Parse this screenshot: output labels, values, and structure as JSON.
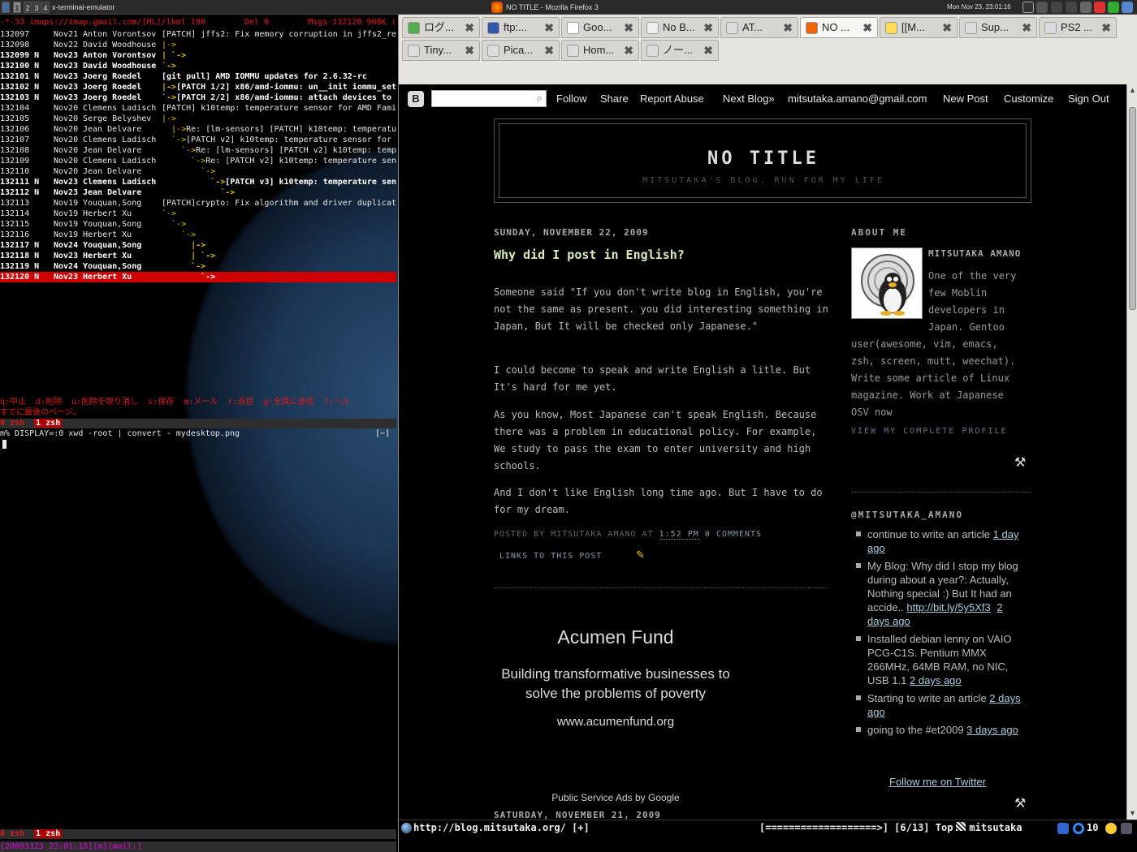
{
  "panel": {
    "workspaces": [
      "1",
      "2",
      "3",
      "4"
    ],
    "terminal_title": "x-terminal-emulator",
    "firefox_title": "NO TITLE - Mozilla Firefox 3",
    "clock": "Mon Nov 23, 23:01:16"
  },
  "mutt": {
    "header": "-*-33 imaps://imap.gmail.com/[ML]/lkml 198        Del 0        Msgs 132120 908K (end)",
    "messages": [
      {
        "num": "132097",
        "flag": "",
        "date": "Nov21",
        "from": "Anton Vorontsov",
        "subject": "[PATCH] jffs2: Fix memory corruption in jffs2_re",
        "bold": false,
        "tree": ""
      },
      {
        "num": "132098",
        "flag": "",
        "date": "Nov22",
        "from": "David Woodhouse",
        "subject": "",
        "bold": false,
        "tree": "|->"
      },
      {
        "num": "132099",
        "flag": "N",
        "date": "Nov23",
        "from": "Anton Vorontsov",
        "subject": "",
        "bold": true,
        "tree": "| `->"
      },
      {
        "num": "132100",
        "flag": "N",
        "date": "Nov23",
        "from": "David Woodhouse",
        "subject": "",
        "bold": true,
        "tree": "`->"
      },
      {
        "num": "132101",
        "flag": "N",
        "date": "Nov23",
        "from": "Joerg Roedel",
        "subject": "[git pull] AMD IOMMU updates for 2.6.32-rc",
        "bold": true,
        "tree": ""
      },
      {
        "num": "132102",
        "flag": "N",
        "date": "Nov23",
        "from": "Joerg Roedel",
        "subject": "[PATCH 1/2] x86/amd-iommu: un__init iommu_set",
        "bold": true,
        "tree": "|->"
      },
      {
        "num": "132103",
        "flag": "N",
        "date": "Nov23",
        "from": "Joerg Roedel",
        "subject": "[PATCH 2/2] x86/amd-iommu: attach devices to",
        "bold": true,
        "tree": "`->"
      },
      {
        "num": "132104",
        "flag": "",
        "date": "Nov20",
        "from": "Clemens Ladisch",
        "subject": "[PATCH] k10temp: temperature sensor for AMD Fami",
        "bold": false,
        "tree": ""
      },
      {
        "num": "132105",
        "flag": "",
        "date": "Nov20",
        "from": "Serge Belyshev",
        "subject": "",
        "bold": false,
        "tree": "|->"
      },
      {
        "num": "132106",
        "flag": "",
        "date": "Nov20",
        "from": "Jean Delvare",
        "subject": "Re: [lm-sensors] [PATCH] k10temp: temperatu",
        "bold": false,
        "tree": "  |->"
      },
      {
        "num": "132107",
        "flag": "",
        "date": "Nov20",
        "from": "Clemens Ladisch",
        "subject": "[PATCH v2] k10temp: temperature sensor for",
        "bold": false,
        "tree": "  `->"
      },
      {
        "num": "132108",
        "flag": "",
        "date": "Nov20",
        "from": "Jean Delvare",
        "subject": "Re: [lm-sensors] [PATCH v2] k10temp: temp",
        "bold": false,
        "tree": "    `->"
      },
      {
        "num": "132109",
        "flag": "",
        "date": "Nov20",
        "from": "Clemens Ladisch",
        "subject": "Re: [PATCH v2] k10temp: temperature sen",
        "bold": false,
        "tree": "      `->"
      },
      {
        "num": "132110",
        "flag": "",
        "date": "Nov20",
        "from": "Jean Delvare",
        "subject": "",
        "bold": false,
        "tree": "        `->"
      },
      {
        "num": "132111",
        "flag": "N",
        "date": "Nov23",
        "from": "Clemens Ladisch",
        "subject": "[PATCH v3] k10temp: temperature sen",
        "bold": true,
        "tree": "          `->"
      },
      {
        "num": "132112",
        "flag": "N",
        "date": "Nov23",
        "from": "Jean Delvare",
        "subject": "",
        "bold": true,
        "tree": "            `->"
      },
      {
        "num": "132113",
        "flag": "",
        "date": "Nov19",
        "from": "Youquan,Song",
        "subject": "[PATCH]crypto: Fix algorithm and driver duplicat",
        "bold": false,
        "tree": ""
      },
      {
        "num": "132114",
        "flag": "",
        "date": "Nov19",
        "from": "Herbert Xu",
        "subject": "",
        "bold": false,
        "tree": "`->"
      },
      {
        "num": "132115",
        "flag": "",
        "date": "Nov19",
        "from": "Youquan,Song",
        "subject": "",
        "bold": false,
        "tree": "  `->"
      },
      {
        "num": "132116",
        "flag": "",
        "date": "Nov19",
        "from": "Herbert Xu",
        "subject": "",
        "bold": false,
        "tree": "    `->"
      },
      {
        "num": "132117",
        "flag": "N",
        "date": "Nov24",
        "from": "Youquan,Song",
        "subject": "",
        "bold": true,
        "tree": "      |->"
      },
      {
        "num": "132118",
        "flag": "N",
        "date": "Nov23",
        "from": "Herbert Xu",
        "subject": "",
        "bold": true,
        "tree": "      | `->"
      },
      {
        "num": "132119",
        "flag": "N",
        "date": "Nov24",
        "from": "Youquan,Song",
        "subject": "",
        "bold": true,
        "tree": "      `->"
      },
      {
        "num": "132120",
        "flag": "N",
        "date": "Nov23",
        "from": "Herbert Xu",
        "subject": "",
        "bold": true,
        "tree": "        `->",
        "selected": true
      }
    ],
    "help_line": "q:中止  d:削除  u:削除を取り消し  s:保存  m:メール  r:返信  g:全員に返信  ?:ヘル",
    "notice": "すでに最後のページ。"
  },
  "screen": {
    "top_bar_current": "0 zsh",
    "top_bar_other": "1 zsh",
    "prompt": "m% DISPLAY=:0 xwd -root | convert - mydesktop.png",
    "prompt_right": "[~]",
    "bottom_bar_current": "0 zsh",
    "bottom_bar_other": "1 zsh",
    "status": "[20091123 23:01:16][m][mail:]"
  },
  "firefox": {
    "tabs_row1": [
      "ログ...",
      "ftp:...",
      "Goo...",
      "No B...",
      "AT...",
      "NO ...",
      "[[M...",
      "Sup...",
      "PS2 ..."
    ],
    "tabs_row2": [
      "Tiny...",
      "Pica...",
      "Hom...",
      "ノー..."
    ],
    "active_tab_index": 5,
    "navbar": {
      "search_placeholder": "",
      "links": [
        "Follow",
        "Share",
        "Report Abuse",
        "Next Blog»",
        "mitsutaka.amano@gmail.com",
        "New Post",
        "Customize",
        "Sign Out"
      ]
    },
    "blog": {
      "title": "NO TITLE",
      "description": "MITSUTAKA'S BLOG. RUN FOR MY LIFE",
      "date": "SUNDAY, NOVEMBER 22, 2009",
      "post_title": "Why did I post in English?",
      "paragraphs": [
        "Someone said \"If you don't write blog in English, you're not the same as present. you did interesting something in Japan, But It will be checked only Japanese.\"",
        "I could become to speak and write English a litle. But It's hard for me yet.",
        "As you know, Most Japanese can't speak English. Because there was a problem in educational policy. For example, We study to pass the exam to enter university and high schools.",
        "And I don't like English long time ago. But I have to do for my dream."
      ],
      "posted_by": "POSTED BY MITSUTAKA AMANO AT",
      "post_time": "1:52 PM",
      "comments": "0 COMMENTS",
      "links": "LINKS TO THIS POST",
      "ad_title": "Acumen Fund",
      "ad_desc": "Building transformative businesses to solve the problems of poverty",
      "ad_url": "www.acumenfund.org",
      "psa": "Public Service Ads by Google",
      "next_date": "SATURDAY, NOVEMBER 21, 2009"
    },
    "sidebar": {
      "about_heading": "ABOUT ME",
      "name": "MITSUTAKA AMANO",
      "bio_top": "One of the very few Moblin developers in Japan. Gentoo",
      "bio_rest": "user(awesome, vim, emacs, zsh, screen, mutt, weechat). Write some article of Linux magazine. Work at Japanese OSV now",
      "view_profile": "VIEW MY COMPLETE PROFILE",
      "twitter_heading": "@MITSUTAKA_AMANO",
      "tweets": [
        {
          "text": "continue to write an article",
          "link": "1 day ago"
        },
        {
          "text": "My Blog: Why did I stop my blog during about a year?: Actually, Nothing special :) But It had an accide..",
          "url": "http://bit.ly/5y5Xf3",
          "link": "2 days ago"
        },
        {
          "text": "Installed debian lenny on VAIO PCG-C1S. Pentium MMX 266MHz, 64MB RAM, no NIC, USB 1.1",
          "link": "2 days ago"
        },
        {
          "text": "Starting to write an article",
          "link": "2 days ago"
        },
        {
          "text": "going to the #et2009",
          "link": "3 days ago"
        }
      ],
      "follow": "Follow me on Twitter"
    },
    "statusbar": {
      "url": "http://blog.mitsutaka.org/ [+]",
      "progress": "[===================>] [6/13] Top",
      "user": "mitsutaka",
      "count": "10"
    }
  }
}
